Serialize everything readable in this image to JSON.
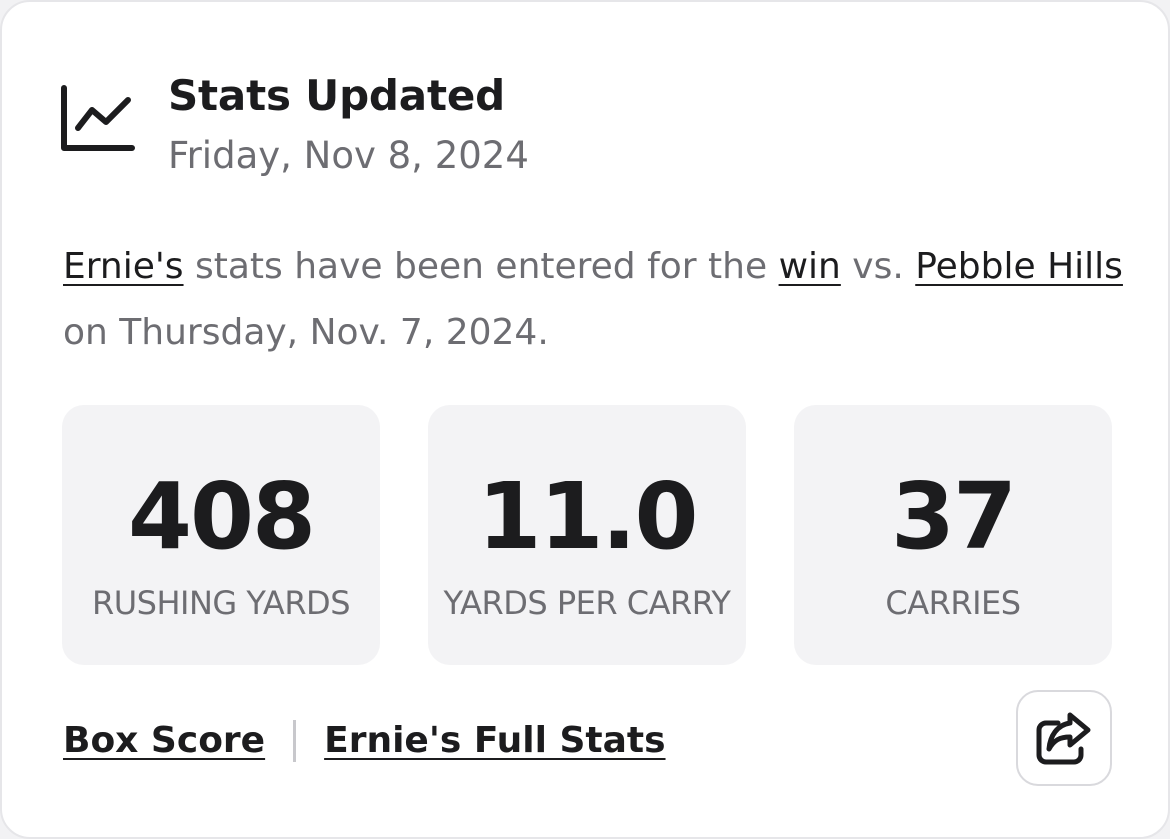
{
  "header": {
    "icon": "chart-line-icon",
    "title": "Stats Updated",
    "date": "Friday, Nov 8, 2024"
  },
  "message": {
    "player_link": "Ernie's",
    "text_1": " stats have been entered for the ",
    "result_link": "win",
    "text_2": " vs. ",
    "opponent_link": "Pebble Hills",
    "text_3": " on Thursday, Nov. 7, 2024."
  },
  "stats": [
    {
      "value": "408",
      "label": "RUSHING YARDS"
    },
    {
      "value": "11.0",
      "label": "YARDS PER CARRY"
    },
    {
      "value": "37",
      "label": "CARRIES"
    }
  ],
  "footer": {
    "box_score_label": "Box Score",
    "full_stats_label": "Ernie's Full Stats",
    "share_icon": "share-icon"
  },
  "colors": {
    "text_primary": "#1c1c1e",
    "text_secondary": "#6d6d72",
    "stat_background": "#f3f3f5"
  }
}
